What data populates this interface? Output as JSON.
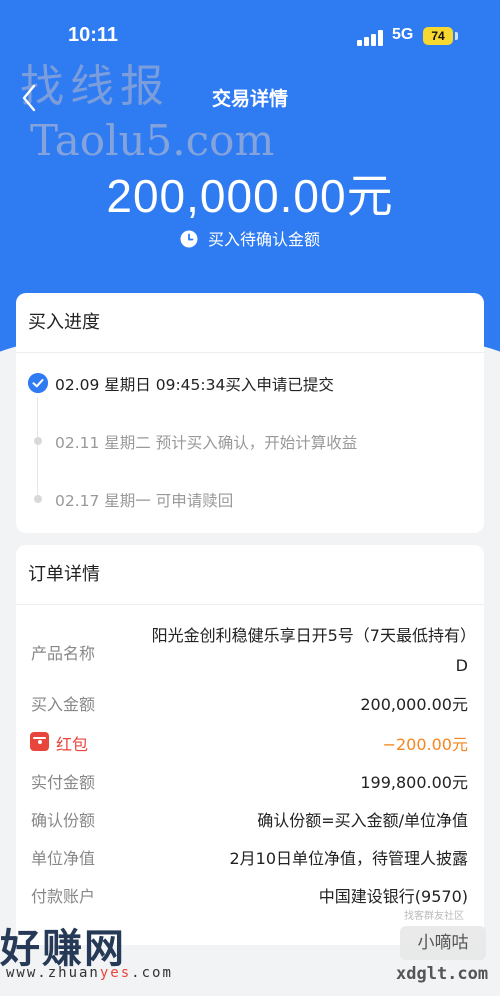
{
  "status": {
    "time": "10:11",
    "network": "5G",
    "battery": "74"
  },
  "nav": {
    "title": "交易详情"
  },
  "summary": {
    "amount": "200,000.00元",
    "subtitle": "买入待确认金额"
  },
  "progress": {
    "title": "买入进度",
    "steps": [
      {
        "text": "02.09 星期日 09:45:34买入申请已提交",
        "state": "done"
      },
      {
        "text": "02.11 星期二 预计买入确认，开始计算收益",
        "state": "pending"
      },
      {
        "text": "02.17 星期一 可申请赎回",
        "state": "pending"
      }
    ]
  },
  "order": {
    "title": "订单详情",
    "rows": [
      {
        "label": "产品名称",
        "value": "阳光金创利稳健乐享日开5号（7天最低持有）D"
      },
      {
        "label": "买入金额",
        "value": "200,000.00元"
      },
      {
        "label": "红包",
        "value": "−200.00元"
      },
      {
        "label": "实付金额",
        "value": "199,800.00元"
      },
      {
        "label": "确认份额",
        "value": "确认份额=买入金额/单位净值"
      },
      {
        "label": "单位净值",
        "value": "2月10日单位净值，待管理人披露"
      },
      {
        "label": "付款账户",
        "value": "中国建设银行(9570)"
      }
    ]
  },
  "colors": {
    "primary": "#2f7bf2",
    "red": "#e8463d",
    "orange": "#f5861f"
  },
  "watermarks": {
    "top": "找线报",
    "top_url": "Taolu5.com",
    "bottom_left": "好赚网",
    "bottom_url_a": "www.zhuan",
    "bottom_url_b": "yes",
    "bottom_url_c": ".com",
    "right_small": "找客群友社区",
    "right_box": "小嘀咕",
    "right_url": "xdglt.com"
  }
}
